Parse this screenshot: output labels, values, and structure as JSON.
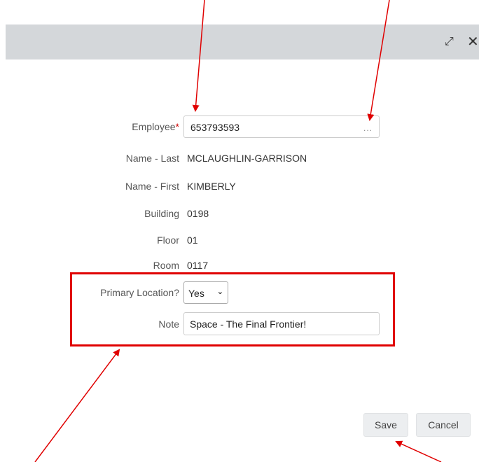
{
  "window": {
    "expand_icon": "expand-icon",
    "close_icon": "close-icon"
  },
  "form": {
    "employee": {
      "label": "Employee",
      "required_mark": "*",
      "value": "653793593",
      "lookup_icon": "..."
    },
    "name_last": {
      "label": "Name - Last",
      "value": "MCLAUGHLIN-GARRISON"
    },
    "name_first": {
      "label": "Name - First",
      "value": "KIMBERLY"
    },
    "building": {
      "label": "Building",
      "value": "0198"
    },
    "floor": {
      "label": "Floor",
      "value": "01"
    },
    "room": {
      "label": "Room",
      "value": "0117"
    },
    "primary_location": {
      "label": "Primary Location?",
      "value": "Yes"
    },
    "note": {
      "label": "Note",
      "value": "Space - The Final Frontier!"
    }
  },
  "buttons": {
    "save": "Save",
    "cancel": "Cancel"
  },
  "annotation_colors": {
    "arrow": "#e00000",
    "highlight_box": "#e00000"
  }
}
